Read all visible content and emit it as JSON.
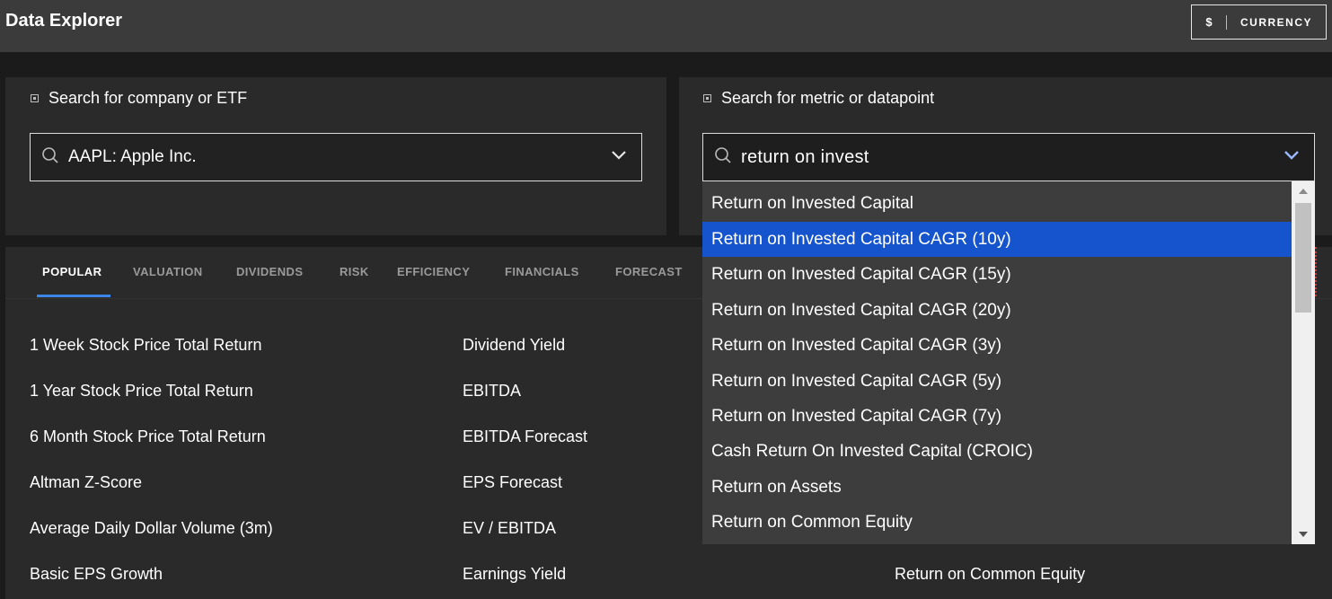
{
  "header": {
    "title": "Data Explorer",
    "currency_symbol": "$",
    "currency_label": "CURRENCY"
  },
  "company_search": {
    "title": "Search for company or ETF",
    "value": "AAPL: Apple Inc."
  },
  "metric_search": {
    "title": "Search for metric or datapoint",
    "value": "return on invest"
  },
  "tabs": [
    "POPULAR",
    "VALUATION",
    "DIVIDENDS",
    "RISK",
    "EFFICIENCY",
    "FINANCIALS",
    "FORECAST"
  ],
  "active_tab": "POPULAR",
  "metrics": {
    "col1": [
      "1 Week Stock Price Total Return",
      "1 Year Stock Price Total Return",
      "6 Month Stock Price Total Return",
      "Altman Z-Score",
      "Average Daily Dollar Volume (3m)",
      "Basic EPS Growth"
    ],
    "col2": [
      "Dividend Yield",
      "EBITDA",
      "EBITDA Forecast",
      "EPS Forecast",
      "EV / EBITDA",
      "Earnings Yield"
    ],
    "col3_visible": "Return on Common Equity"
  },
  "dropdown": {
    "items": [
      "Return on Invested Capital",
      "Return on Invested Capital CAGR (10y)",
      "Return on Invested Capital CAGR (15y)",
      "Return on Invested Capital CAGR (20y)",
      "Return on Invested Capital CAGR (3y)",
      "Return on Invested Capital CAGR (5y)",
      "Return on Invested Capital CAGR (7y)",
      "Cash Return On Invested Capital (CROIC)",
      "Return on Assets",
      "Return on Common Equity"
    ],
    "selected_index": 1
  },
  "colors": {
    "topbar": "#3b3b3b",
    "panel": "#2a2a2a",
    "accent": "#3b86e8",
    "selected_row": "#1554cc"
  }
}
